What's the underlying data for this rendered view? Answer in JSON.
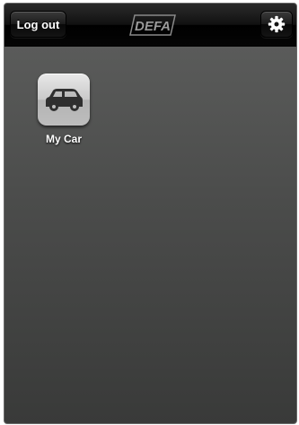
{
  "navbar": {
    "logout_label": "Log out",
    "brand": "DEFA",
    "settings_icon": "gear-icon"
  },
  "apps": [
    {
      "label": "My Car",
      "icon": "car-icon"
    }
  ]
}
